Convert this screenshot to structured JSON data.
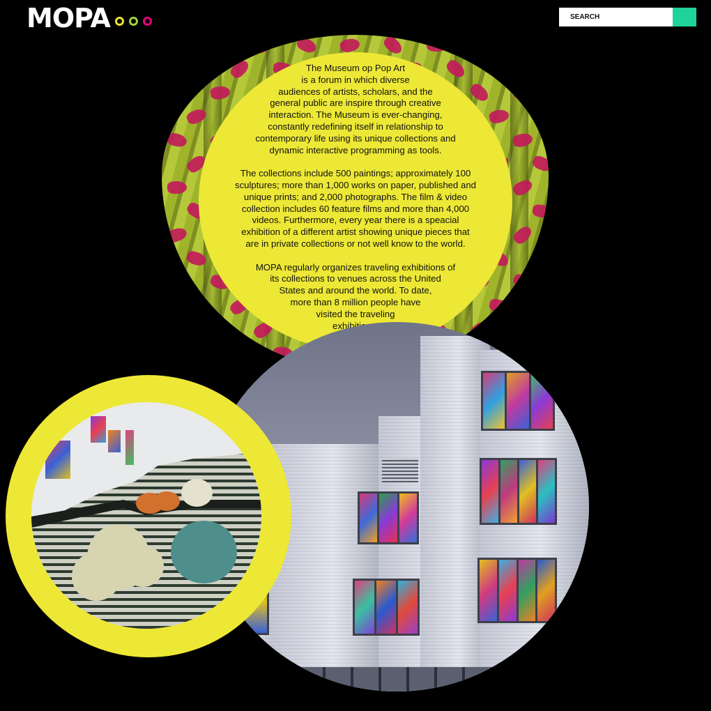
{
  "header": {
    "logo_text": "MOPA",
    "dots": [
      {
        "color": "#e9e436"
      },
      {
        "color": "#9fd43a"
      },
      {
        "color": "#e6007e"
      }
    ],
    "search": {
      "placeholder": "SEARCH",
      "button_color": "#1ed39a"
    }
  },
  "about": {
    "paragraph1_lines": [
      "The Museum op Pop Art",
      "is a forum in which diverse",
      "audiences of artists, scholars, and the",
      "general public are inspire through creative",
      "interaction. The Museum is ever-changing,",
      "constantly redefining itself in relationship to",
      "contemporary life using its unique collections and",
      "dynamic interactive programming as tools."
    ],
    "paragraph2_lines": [
      "The collections include 500 paintings; approximately 100",
      "sculptures; more than 1,000 works on paper, published and",
      "unique prints; and 2,000 photographs. The film & video",
      "collection includes 60 feature films and more than 4,000",
      "videos. Furthermore, every year there is a speacial",
      "exhibition of a different artist showing unique pieces that",
      "are in private collections or not well know to the world."
    ],
    "paragraph3_lines": [
      "MOPA regularly organizes traveling exhibitions of",
      "its collections to venues across the United",
      "States and around the world. To date,",
      "more than 8 million people have",
      "visited the traveling",
      "exhibitions,"
    ]
  },
  "colors": {
    "background": "#000000",
    "accent_yellow": "#ede836",
    "accent_green": "#1ed39a",
    "accent_pink": "#e6007e"
  }
}
